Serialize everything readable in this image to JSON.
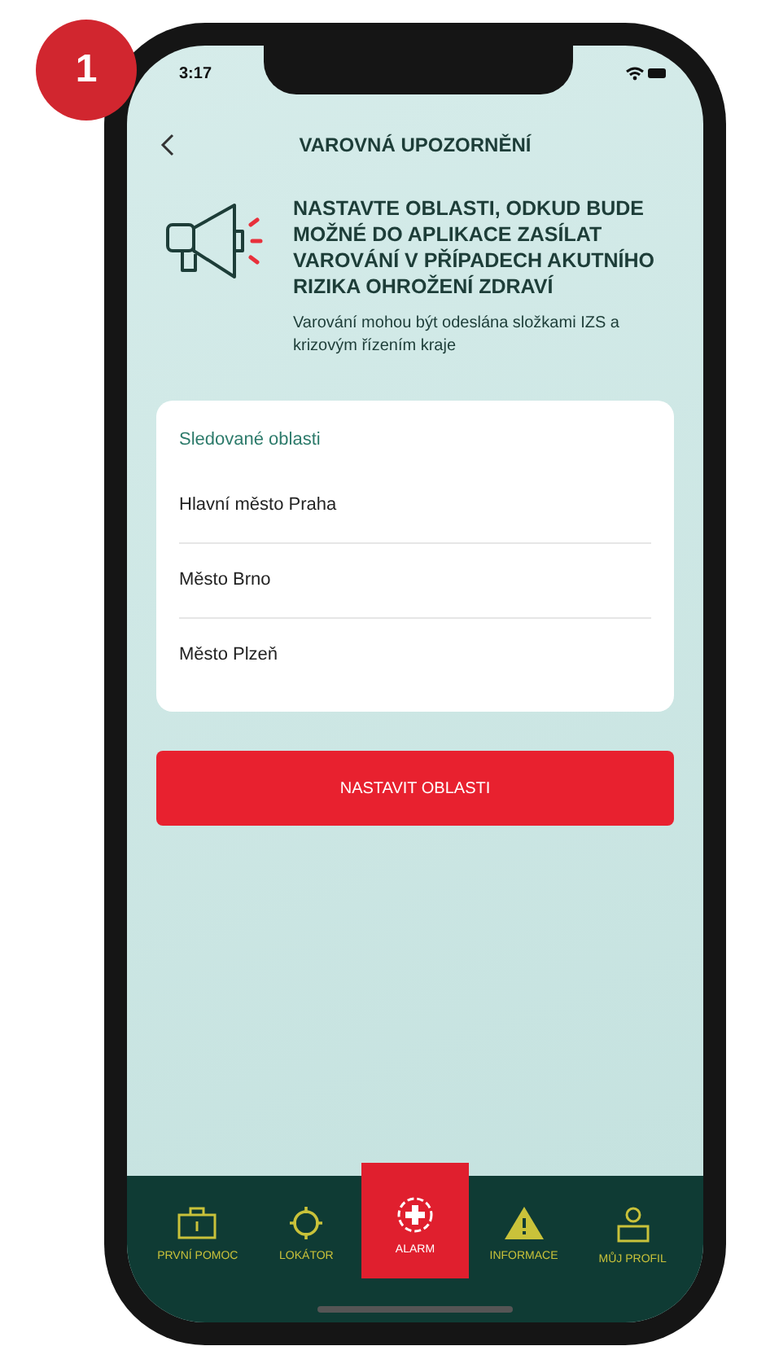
{
  "badge": "1",
  "status_bar": {
    "time": "3:17"
  },
  "header": {
    "title": "VAROVNÁ UPOZORNĚNÍ"
  },
  "intro": {
    "heading": "NASTAVTE OBLASTI, ODKUD BUDE MOŽNÉ DO APLIKACE ZASÍLAT VAROVÁNÍ V PŘÍPADECH AKUTNÍHO RIZIKA OHROŽENÍ ZDRAVÍ",
    "note": "Varování mohou být odeslána složkami IZS a krizovým řízením kraje"
  },
  "card": {
    "title": "Sledované oblasti",
    "items": [
      "Hlavní město Praha",
      "Město Brno",
      "Město Plzeň"
    ]
  },
  "button": "NASTAVIT OBLASTI",
  "tabs": [
    {
      "label": "PRVNÍ POMOC",
      "kind": "first-aid",
      "selected": false
    },
    {
      "label": "LOKÁTOR",
      "kind": "locator",
      "selected": false
    },
    {
      "label": "ALARM",
      "kind": "alarm",
      "selected": true
    },
    {
      "label": "INFORMACE",
      "kind": "info",
      "selected": false
    },
    {
      "label": "MŮJ PROFIL",
      "kind": "profile",
      "selected": false
    }
  ]
}
